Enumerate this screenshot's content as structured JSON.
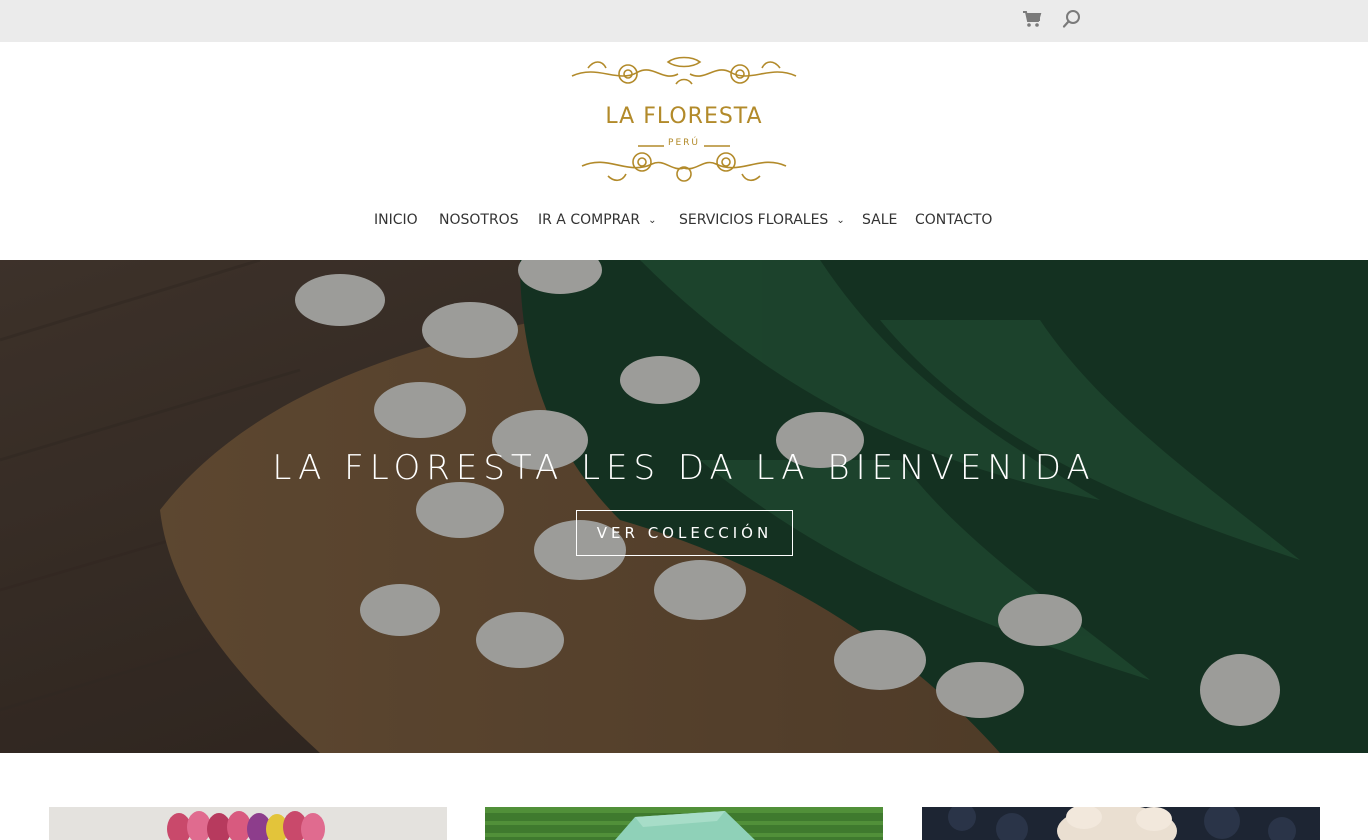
{
  "brand": {
    "name": "LA FLORESTA",
    "country": "PERÚ",
    "gold_color": "#b28a2a"
  },
  "topbar": {
    "cart_icon": "cart-icon",
    "search_icon": "search-icon"
  },
  "nav": {
    "items": [
      {
        "label": "INICIO",
        "has_dropdown": false
      },
      {
        "label": "NOSOTROS",
        "has_dropdown": false
      },
      {
        "label": "IR A COMPRAR",
        "has_dropdown": true
      },
      {
        "label": "SERVICIOS FLORALES",
        "has_dropdown": true
      },
      {
        "label": "SALE",
        "has_dropdown": false
      },
      {
        "label": "CONTACTO",
        "has_dropdown": false
      }
    ],
    "dropdown_glyph": "⌄"
  },
  "hero": {
    "title": "LA FLORESTA LES DA LA BIENVENIDA",
    "button_label": "VER COLECCIÓN"
  },
  "cards": [
    {
      "name": "tulips-card"
    },
    {
      "name": "green-box-card"
    },
    {
      "name": "plush-card"
    }
  ]
}
